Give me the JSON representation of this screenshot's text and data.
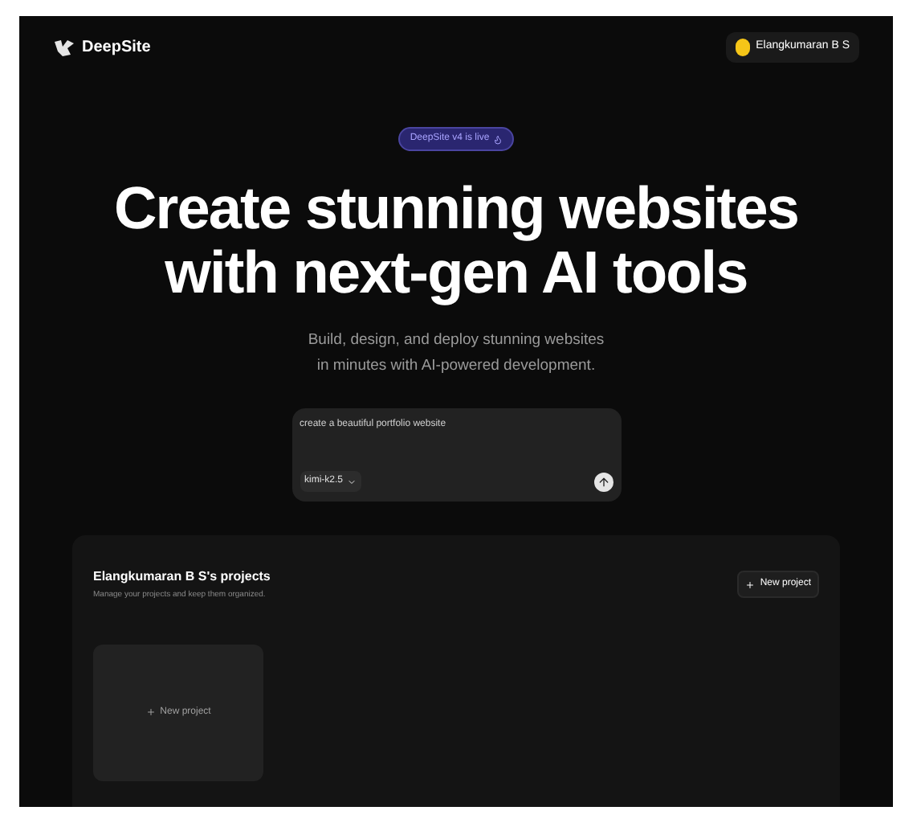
{
  "header": {
    "brand": "DeepSite",
    "user": {
      "name": "Elangkumaran B S"
    }
  },
  "hero": {
    "badge": "DeepSite v4 is live",
    "title_lines": [
      "Create stunning websites",
      "with next-gen AI tools"
    ],
    "subtitle_lines": [
      "Build, design, and deploy stunning websites",
      "in minutes with AI-powered development."
    ]
  },
  "prompt": {
    "value": "create a beautiful portfolio website",
    "model": "kimi-k2.5"
  },
  "projects": {
    "title": "Elangkumaran B S's projects",
    "description": "Manage your projects and keep them organized.",
    "new_button": "New project",
    "cards": [
      {
        "kind": "new",
        "label": "New project"
      }
    ]
  }
}
